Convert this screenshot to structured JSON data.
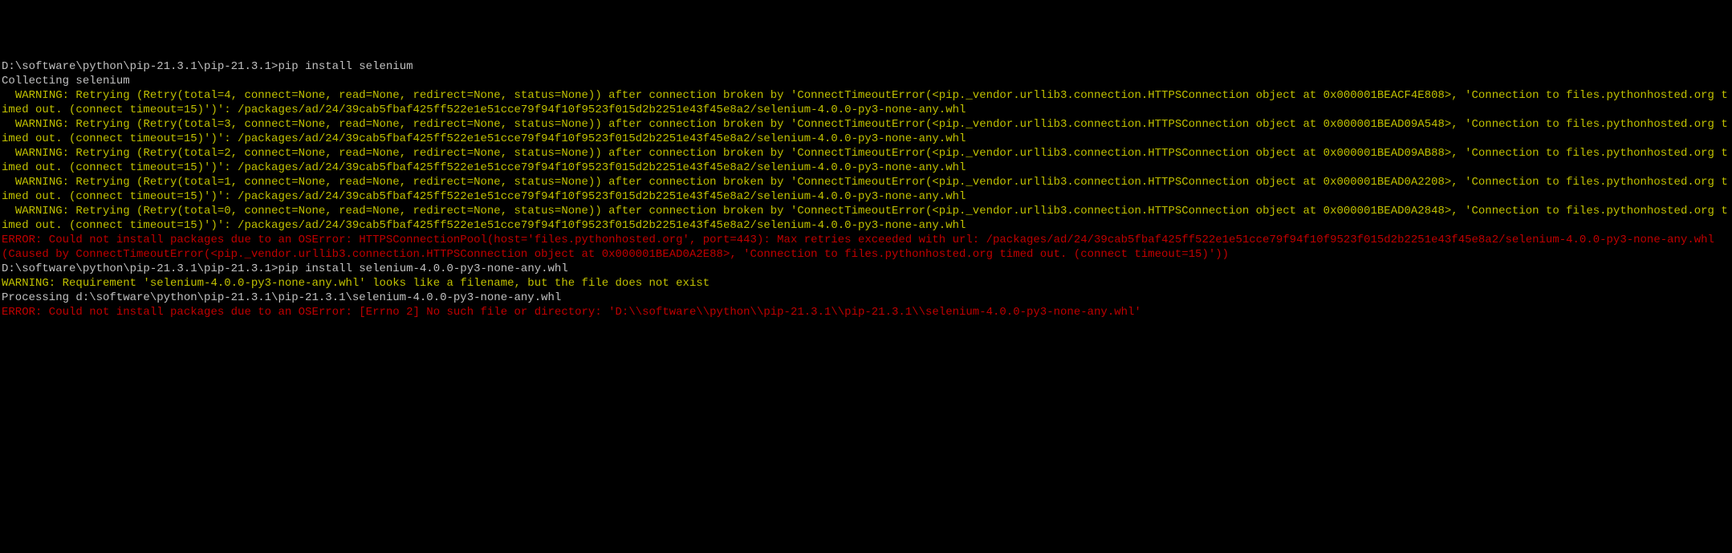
{
  "prompt1": "D:\\software\\python\\pip-21.3.1\\pip-21.3.1>",
  "command1": "pip install selenium",
  "collecting": "Collecting selenium",
  "warning1": "  WARNING: Retrying (Retry(total=4, connect=None, read=None, redirect=None, status=None)) after connection broken by 'ConnectTimeoutError(<pip._vendor.urllib3.connection.HTTPSConnection object at 0x000001BEACF4E808>, 'Connection to files.pythonhosted.org timed out. (connect timeout=15)')': /packages/ad/24/39cab5fbaf425ff522e1e51cce79f94f10f9523f015d2b2251e43f45e8a2/selenium-4.0.0-py3-none-any.whl",
  "warning2": "  WARNING: Retrying (Retry(total=3, connect=None, read=None, redirect=None, status=None)) after connection broken by 'ConnectTimeoutError(<pip._vendor.urllib3.connection.HTTPSConnection object at 0x000001BEAD09A548>, 'Connection to files.pythonhosted.org timed out. (connect timeout=15)')': /packages/ad/24/39cab5fbaf425ff522e1e51cce79f94f10f9523f015d2b2251e43f45e8a2/selenium-4.0.0-py3-none-any.whl",
  "warning3": "  WARNING: Retrying (Retry(total=2, connect=None, read=None, redirect=None, status=None)) after connection broken by 'ConnectTimeoutError(<pip._vendor.urllib3.connection.HTTPSConnection object at 0x000001BEAD09AB88>, 'Connection to files.pythonhosted.org timed out. (connect timeout=15)')': /packages/ad/24/39cab5fbaf425ff522e1e51cce79f94f10f9523f015d2b2251e43f45e8a2/selenium-4.0.0-py3-none-any.whl",
  "warning4": "  WARNING: Retrying (Retry(total=1, connect=None, read=None, redirect=None, status=None)) after connection broken by 'ConnectTimeoutError(<pip._vendor.urllib3.connection.HTTPSConnection object at 0x000001BEAD0A2208>, 'Connection to files.pythonhosted.org timed out. (connect timeout=15)')': /packages/ad/24/39cab5fbaf425ff522e1e51cce79f94f10f9523f015d2b2251e43f45e8a2/selenium-4.0.0-py3-none-any.whl",
  "warning5": "  WARNING: Retrying (Retry(total=0, connect=None, read=None, redirect=None, status=None)) after connection broken by 'ConnectTimeoutError(<pip._vendor.urllib3.connection.HTTPSConnection object at 0x000001BEAD0A2848>, 'Connection to files.pythonhosted.org timed out. (connect timeout=15)')': /packages/ad/24/39cab5fbaf425ff522e1e51cce79f94f10f9523f015d2b2251e43f45e8a2/selenium-4.0.0-py3-none-any.whl",
  "error1": "ERROR: Could not install packages due to an OSError: HTTPSConnectionPool(host='files.pythonhosted.org', port=443): Max retries exceeded with url: /packages/ad/24/39cab5fbaf425ff522e1e51cce79f94f10f9523f015d2b2251e43f45e8a2/selenium-4.0.0-py3-none-any.whl (Caused by ConnectTimeoutError(<pip._vendor.urllib3.connection.HTTPSConnection object at 0x000001BEAD0A2E88>, 'Connection to files.pythonhosted.org timed out. (connect timeout=15)'))",
  "blank1": "",
  "prompt2": "D:\\software\\python\\pip-21.3.1\\pip-21.3.1>",
  "command2": "pip install selenium-4.0.0-py3-none-any.whl",
  "warning6": "WARNING: Requirement 'selenium-4.0.0-py3-none-any.whl' looks like a filename, but the file does not exist",
  "processing": "Processing d:\\software\\python\\pip-21.3.1\\pip-21.3.1\\selenium-4.0.0-py3-none-any.whl",
  "error2": "ERROR: Could not install packages due to an OSError: [Errno 2] No such file or directory: 'D:\\\\software\\\\python\\\\pip-21.3.1\\\\pip-21.3.1\\\\selenium-4.0.0-py3-none-any.whl'"
}
